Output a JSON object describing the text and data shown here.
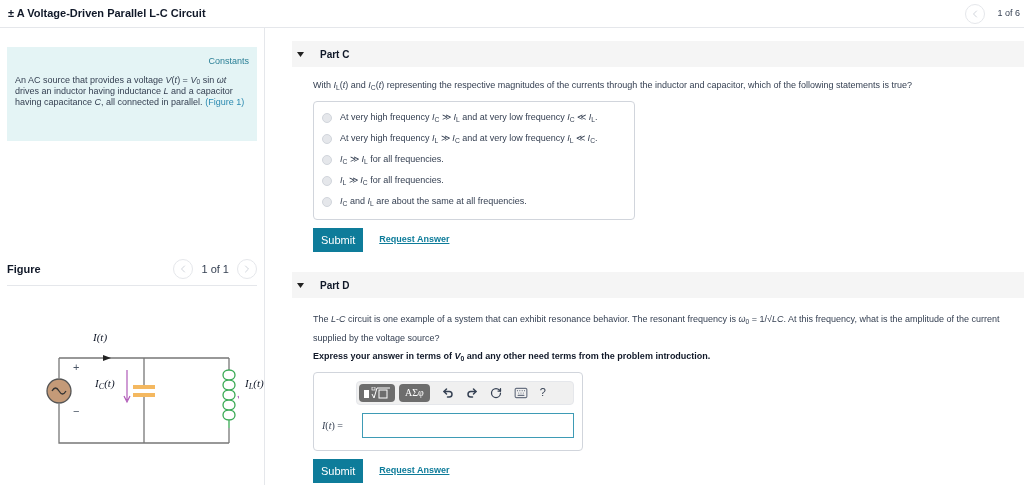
{
  "header": {
    "title": "± A Voltage-Driven Parallel L-C Circuit",
    "pager": "1 of 6"
  },
  "constants": {
    "title": "Constants",
    "text": "An AC source that provides a voltage *V*(*t*) = *V*$_{0}$ sin *ωt* drives an inductor having inductance *L* and a capacitor having capacitance *C*, all connected in parallel.",
    "link": "(Figure 1)"
  },
  "figure": {
    "title": "Figure",
    "pager": "1 of 1",
    "labels": {
      "source_current": "I(t)",
      "capacitor_current": "I$_{C}$(t)",
      "inductor_current": "I$_{L}$(t)",
      "plus": "+",
      "minus": "−"
    }
  },
  "parts": [
    {
      "kind": "choice",
      "title": "Part C",
      "question": "With *I*$_{L}$(*t*) and *I*$_{C}$(*t*) representing the respective magnitudes of the currents through the inductor and capacitor, which of the following statements is true?",
      "options": [
        {
          "text": "At very high frequency *I*$_{C}$ ≫ *I*$_{L}$ and at very low frequency *I*$_{C}$ ≪ *I*$_{L}$.",
          "selected": false
        },
        {
          "text": "At very high frequency *I*$_{L}$ ≫ *I*$_{C}$ and at very low frequency *I*$_{L}$ ≪ *I*$_{C}$.",
          "selected": false
        },
        {
          "text": "*I*$_{C}$ ≫ *I*$_{L}$ for all frequencies.",
          "selected": false
        },
        {
          "text": "*I*$_{L}$ ≫ *I*$_{C}$ for all frequencies.",
          "selected": false
        },
        {
          "text": "*I*$_{C}$ and *I*$_{L}$ are about the same at all frequencies.",
          "selected": false
        }
      ],
      "submit": "Submit",
      "request": "Request Answer"
    },
    {
      "kind": "answer",
      "title": "Part D",
      "question": "The *L*-*C* circuit is one example of a system that can exhibit resonance behavior. The resonant frequency is *ω*$_{0}$ = 1/√*LC*. At this frequency, what is the amplitude of the current supplied by the voltage source?",
      "instruction": "Express your answer in terms of *V*$_{0}$ and any other need terms from the problem introduction.",
      "symbols": "ΑΣφ",
      "help": "?",
      "input_label": "*I*(*t*) =",
      "submit": "Submit",
      "request": "Request Answer"
    }
  ]
}
